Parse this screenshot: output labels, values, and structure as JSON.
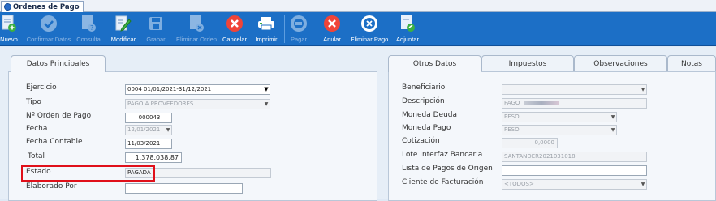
{
  "doc_tab": {
    "title": "Ordenes de Pago"
  },
  "toolbar": {
    "nuevo": "Nuevo",
    "confirmar": "Confirmar Datos",
    "consulta": "Consulta",
    "modificar": "Modificar",
    "grabar": "Grabar",
    "eliminar_orden": "Eliminar Orden",
    "cancelar": "Cancelar",
    "imprimir": "Imprimir",
    "pagar": "Pagar",
    "anular": "Anular",
    "eliminar_pago": "Eliminar Pago",
    "adjuntar": "Adjuntar"
  },
  "left_panel": {
    "tab": "Datos Principales",
    "fields": {
      "ejercicio": {
        "label": "Ejercicio",
        "value": "0004 01/01/2021-31/12/2021"
      },
      "tipo": {
        "label": "Tipo",
        "value": "PAGO A PROVEEDORES"
      },
      "nro_orden": {
        "label": "Nº Orden de Pago",
        "value": "000043"
      },
      "fecha": {
        "label": "Fecha",
        "value": "12/01/2021"
      },
      "fecha_contable": {
        "label": "Fecha Contable",
        "value": "11/03/2021"
      },
      "total": {
        "label": "Total",
        "value": "1.378.038,87"
      },
      "estado": {
        "label": "Estado",
        "value": "PAGADA"
      },
      "elaborado_por": {
        "label": "Elaborado Por",
        "value": ""
      }
    }
  },
  "right_panel": {
    "tabs": [
      "Otros Datos",
      "Impuestos",
      "Observaciones",
      "Notas"
    ],
    "fields": {
      "beneficiario": {
        "label": "Beneficiario",
        "value": ""
      },
      "descripcion": {
        "label": "Descripción",
        "value": "PAGO"
      },
      "moneda_deuda": {
        "label": "Moneda Deuda",
        "value": "PESO"
      },
      "moneda_pago": {
        "label": "Moneda Pago",
        "value": "PESO"
      },
      "cotizacion": {
        "label": "Cotización",
        "value": "0,0000"
      },
      "lote": {
        "label": "Lote Interfaz Bancaria",
        "value": "SANTANDER2021031018"
      },
      "lista_pagos": {
        "label": "Lista de Pagos de Origen",
        "value": ""
      },
      "cliente": {
        "label": "Cliente de Facturación",
        "value": "<TODOS>"
      }
    }
  },
  "colors": {
    "toolbar": "#1c6fc6",
    "highlight": "#e0101a"
  }
}
